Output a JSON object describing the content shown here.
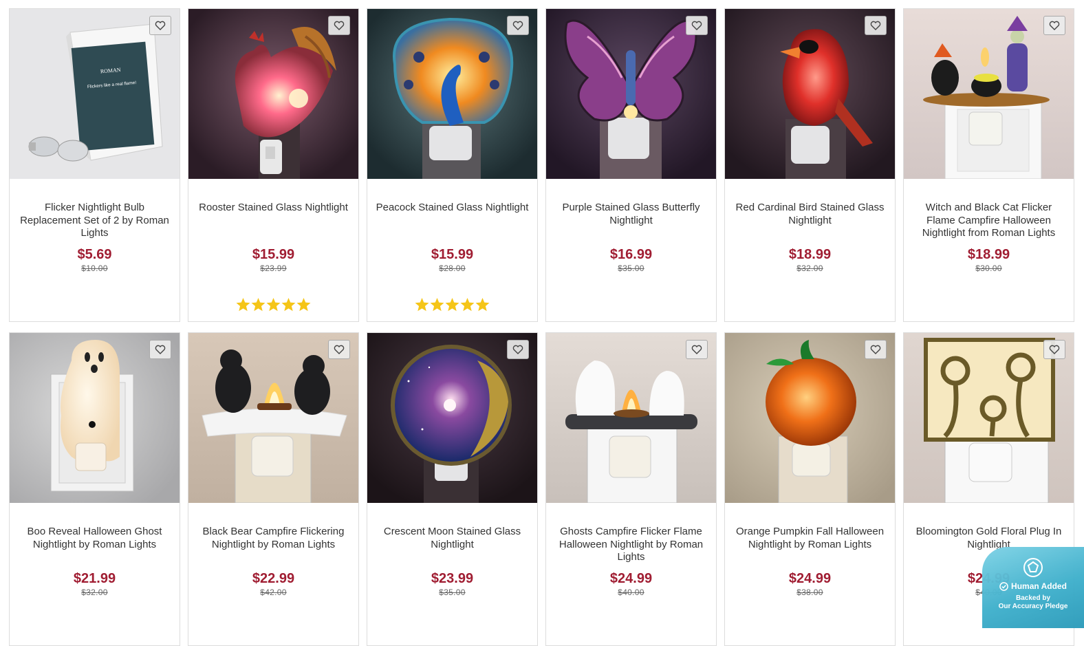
{
  "products": [
    {
      "title": "Flicker Nightlight Bulb Replacement Set of 2 by Roman Lights",
      "price": "$5.69",
      "original": "$10.00",
      "stars": 0
    },
    {
      "title": "Rooster Stained Glass Nightlight",
      "price": "$15.99",
      "original": "$23.99",
      "stars": 5
    },
    {
      "title": "Peacock Stained Glass Nightlight",
      "price": "$15.99",
      "original": "$28.00",
      "stars": 5
    },
    {
      "title": "Purple Stained Glass Butterfly Nightlight",
      "price": "$16.99",
      "original": "$35.00",
      "stars": 0
    },
    {
      "title": "Red Cardinal Bird Stained Glass Nightlight",
      "price": "$18.99",
      "original": "$32.00",
      "stars": 0
    },
    {
      "title": "Witch and Black Cat Flicker Flame Campfire Halloween Nightlight from Roman Lights",
      "price": "$18.99",
      "original": "$30.00",
      "stars": 0
    },
    {
      "title": "Boo Reveal Halloween Ghost Nightlight by Roman Lights",
      "price": "$21.99",
      "original": "$32.00",
      "stars": 0
    },
    {
      "title": "Black Bear Campfire Flickering Nightlight by Roman Lights",
      "price": "$22.99",
      "original": "$42.00",
      "stars": 0
    },
    {
      "title": "Crescent Moon Stained Glass Nightlight",
      "price": "$23.99",
      "original": "$35.00",
      "stars": 0
    },
    {
      "title": "Ghosts Campfire Flicker Flame Halloween Nightlight by Roman Lights",
      "price": "$24.99",
      "original": "$40.00",
      "stars": 0
    },
    {
      "title": "Orange Pumpkin Fall Halloween Nightlight by Roman Lights",
      "price": "$24.99",
      "original": "$38.00",
      "stars": 0
    },
    {
      "title": "Bloomington Gold Floral Plug In Nightlight",
      "price": "$24.99",
      "original": "$40.00",
      "stars": 0
    }
  ],
  "packaging": {
    "brand": "ROMAN",
    "tagline": "Flickers like a real flame!"
  },
  "badge": {
    "heading": "Human Added",
    "line1": "Backed by",
    "line2": "Our Accuracy Pledge"
  },
  "colors": {
    "price": "#a01d32",
    "star": "#f5c518",
    "badge": "#3fb0cc"
  },
  "icons": {
    "favorite": "heart-outline-icon",
    "rating": "star-icon"
  }
}
